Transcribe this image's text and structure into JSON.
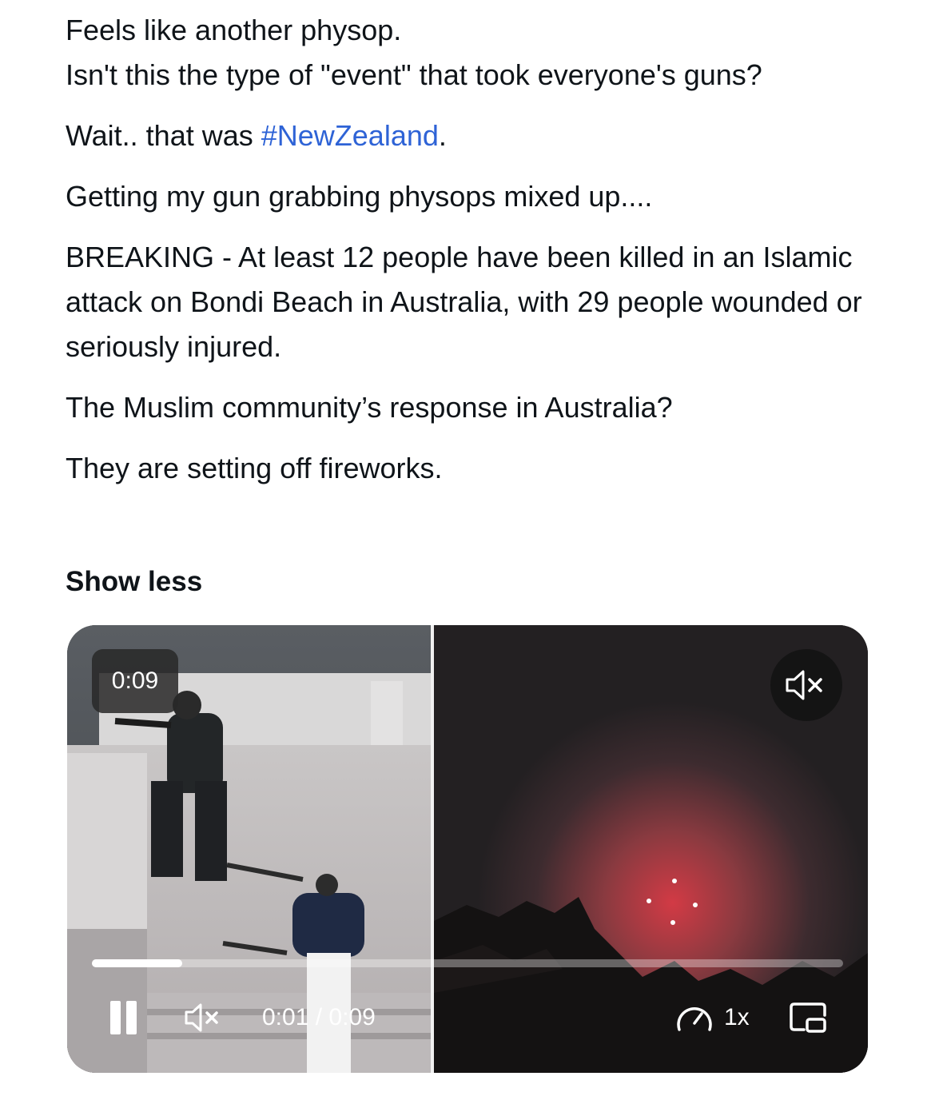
{
  "post": {
    "lines": [
      "Feels like another physop.",
      "Isn't this the type of \"event\" that  took everyone's guns?"
    ],
    "p2_before": "Wait.. that was ",
    "p2_hashtag": "#NewZealand",
    "p2_after": ".",
    "p3": "Getting my gun grabbing physops mixed up....",
    "p4": "BREAKING - At least 12 people have been killed in an Islamic attack on Bondi Beach in Australia, with 29 people wounded or seriously injured.",
    "p5": "The Muslim community’s response in Australia?",
    "p6": "They are setting off fireworks."
  },
  "show_less_label": "Show less",
  "video": {
    "duration_badge": "0:09",
    "time_display": "0:01 / 0:09",
    "speed_label": "1x",
    "progress_fraction": 0.12,
    "mute_icon": "speaker-muted-icon",
    "speed_icon": "speedometer-icon",
    "pip_icon": "picture-in-picture-icon",
    "pause_icon": "pause-icon"
  },
  "colors": {
    "hashtag": "#2e63d6",
    "text": "#0f1419"
  }
}
